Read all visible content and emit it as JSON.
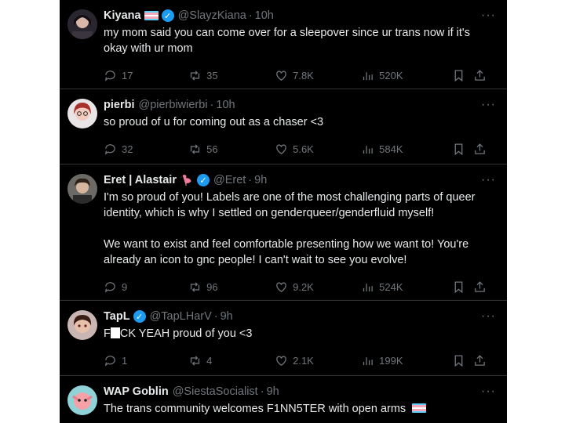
{
  "tweets": [
    {
      "name": "Kiyana",
      "handle": "@SlayzKiana",
      "time": "10h",
      "verified": true,
      "flag": true,
      "text": "my mom said you can come over for a sleepover since ur trans now if it's okay with ur mom",
      "stats": {
        "replies": "17",
        "retweets": "35",
        "likes": "7.8K",
        "views": "520K"
      }
    },
    {
      "name": "pierbi",
      "handle": "@pierbiwierbi",
      "time": "10h",
      "text": "so proud of u for coming out as a chaser <3",
      "stats": {
        "replies": "32",
        "retweets": "56",
        "likes": "5.6K",
        "views": "584K"
      }
    },
    {
      "name": "Eret | Alastair",
      "handle": "@Eret",
      "time": "9h",
      "verified": true,
      "flamingo": true,
      "text": "I'm so proud of you! Labels are one of the most challenging parts of queer identity, which is why I settled on genderqueer/genderfluid myself!\n\nWe want to exist and feel comfortable presenting how we want to! You're already an icon to gnc people! I can't wait to see you evolve!",
      "stats": {
        "replies": "9",
        "retweets": "96",
        "likes": "9.2K",
        "views": "524K"
      }
    },
    {
      "name": "TapL",
      "handle": "@TapLHarV",
      "time": "9h",
      "verified": true,
      "text_a": "F",
      "text_b": "CK YEAH proud of you <3",
      "stats": {
        "replies": "1",
        "retweets": "4",
        "likes": "2.1K",
        "views": "199K"
      }
    },
    {
      "name": "WAP Goblin",
      "handle": "@SiestaSocialist",
      "time": "9h",
      "text": "The trans community welcomes F1NN5TER with open arms"
    }
  ],
  "colors": {
    "background": "#000000",
    "text": "#e7e9ea",
    "muted": "#71767b",
    "verified": "#1d9bf0",
    "divider": "#2f3336"
  },
  "separator": "·",
  "more_label": "···"
}
